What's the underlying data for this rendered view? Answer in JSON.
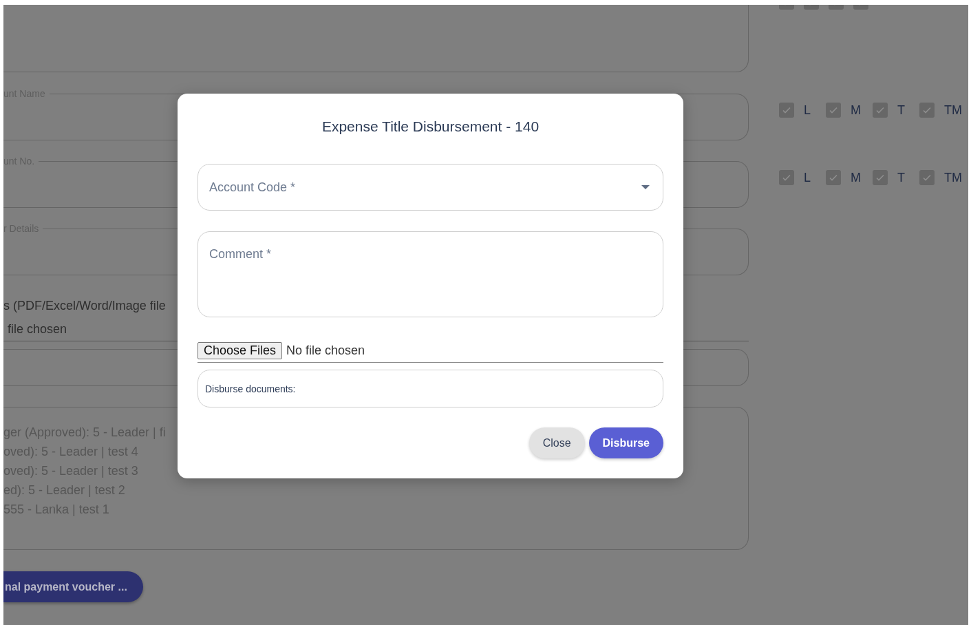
{
  "background": {
    "fields": [
      {
        "kind": "cut"
      },
      {
        "kind": "outlined",
        "label": "unt Name"
      },
      {
        "kind": "outlined",
        "label": "unt No."
      },
      {
        "kind": "outlined",
        "label": "r Details"
      },
      {
        "kind": "upload",
        "label": "s (PDF/Excel/Word/Image file",
        "status": "file chosen"
      },
      {
        "kind": "outlined"
      },
      {
        "kind": "history",
        "lines": [
          "ger (Approved): 5 - Leader | fi",
          "oved): 5 - Leader | test 4",
          "oved): 5 - Leader | test 3",
          "ed): 5 - Leader | test 2",
          "555 - Lanka | test 1"
        ]
      }
    ],
    "voucher_button": "nal payment voucher ...",
    "checkbox_rows": [
      {
        "items": [
          {
            "checked": true
          },
          {
            "checked": true
          },
          {
            "checked": true
          },
          {
            "checked": true
          }
        ]
      },
      {
        "items": [
          {
            "label": "L",
            "checked": true
          },
          {
            "label": "M",
            "checked": true
          },
          {
            "label": "T",
            "checked": true
          },
          {
            "label": "TM",
            "checked": true
          }
        ]
      },
      {
        "items": [
          {
            "label": "L",
            "checked": true
          },
          {
            "label": "M",
            "checked": true
          },
          {
            "label": "T",
            "checked": true
          },
          {
            "label": "TM",
            "checked": true
          }
        ]
      }
    ]
  },
  "dialog": {
    "title": "Expense Title Disbursement - 140",
    "account_code": {
      "placeholder": "Account Code *"
    },
    "comment": {
      "placeholder": "Comment *"
    },
    "file_input": {
      "button": "Choose Files",
      "status": "No file chosen"
    },
    "documents": {
      "label": "Disburse documents:"
    },
    "buttons": [
      {
        "label": "Close",
        "kind": "secondary"
      },
      {
        "label": "Disburse",
        "kind": "primary"
      }
    ]
  }
}
